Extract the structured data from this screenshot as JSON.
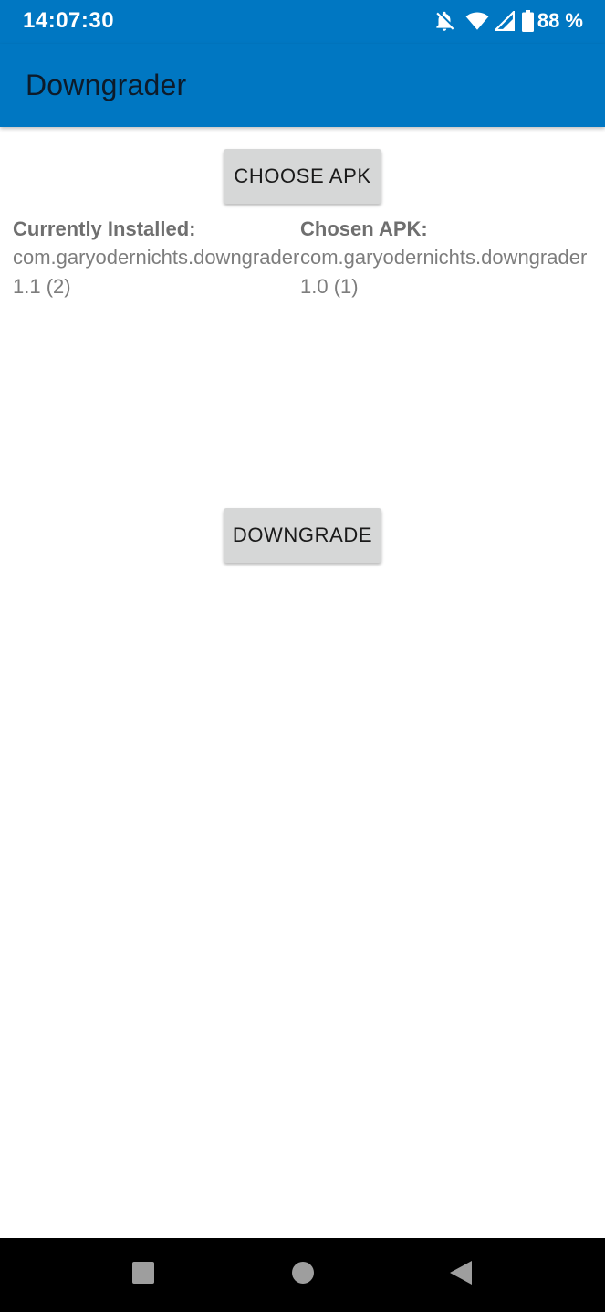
{
  "status_bar": {
    "time": "14:07:30",
    "battery_percent": "88 %",
    "icons": [
      "notifications-off-icon",
      "wifi-icon",
      "cell-signal-icon",
      "battery-icon"
    ]
  },
  "app_bar": {
    "title": "Downgrader"
  },
  "main": {
    "choose_button_label": "CHOOSE APK",
    "installed": {
      "label": "Currently Installed:",
      "package": "com.garyodernichts.downgrader",
      "version": "1.1 (2)"
    },
    "chosen": {
      "label": "Chosen APK:",
      "package": "com.garyodernichts.downgrader",
      "version": "1.0 (1)"
    },
    "downgrade_button_label": "DOWNGRADE"
  },
  "nav_bar": {
    "icons": [
      "recents-icon",
      "home-icon",
      "back-icon"
    ]
  },
  "colors": {
    "primary": "#0077c2",
    "button": "#d6d7d7",
    "nav_bar": "#000000"
  }
}
